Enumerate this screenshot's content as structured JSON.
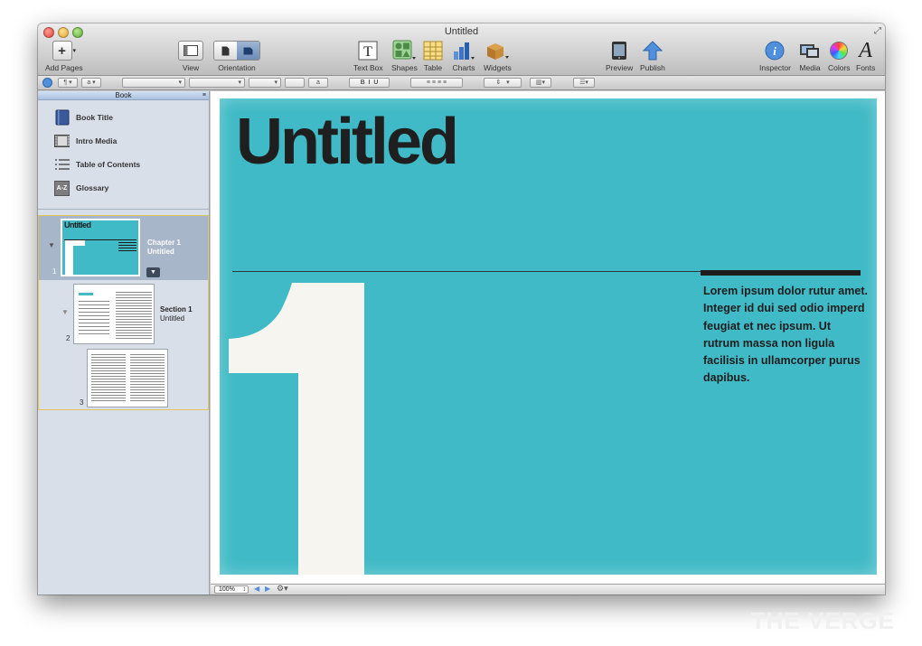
{
  "window": {
    "title": "Untitled"
  },
  "toolbar": {
    "add_pages": "Add Pages",
    "view": "View",
    "orientation": "Orientation",
    "text_box": "Text Box",
    "shapes": "Shapes",
    "table": "Table",
    "charts": "Charts",
    "widgets": "Widgets",
    "preview": "Preview",
    "publish": "Publish",
    "inspector": "Inspector",
    "media": "Media",
    "colors": "Colors",
    "fonts": "Fonts"
  },
  "format_bar": {
    "font_size_a": "a"
  },
  "sidebar": {
    "header": "Book",
    "items": [
      {
        "label": "Book Title",
        "icon": "book-icon"
      },
      {
        "label": "Intro Media",
        "icon": "film-icon"
      },
      {
        "label": "Table of Contents",
        "icon": "list-icon"
      },
      {
        "label": "Glossary",
        "icon": "glossary-icon"
      }
    ],
    "chapter": {
      "label": "Chapter 1",
      "subtitle": "Untitled",
      "number": "1",
      "thumb_title": "Untitled"
    },
    "section": {
      "label": "Section 1",
      "subtitle": "Untitled",
      "number": "2"
    },
    "page3": {
      "number": "3"
    }
  },
  "page": {
    "title": "Untitled",
    "numeral": "1",
    "body": "Lorem ipsum dolor rutur amet. Integer id dui sed odio imperd feugiat et nec ipsum. Ut rutrum massa non ligula facilisis in ullamcorper purus dapibus.",
    "background": "#3fbac6"
  },
  "status": {
    "zoom": "100%"
  },
  "watermark": "THE VERGE"
}
